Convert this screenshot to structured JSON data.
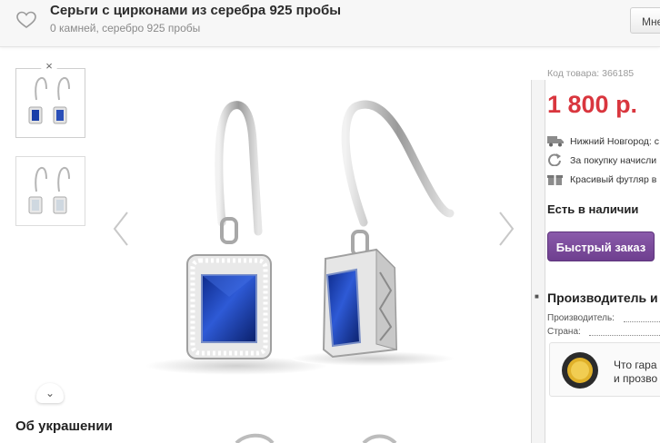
{
  "header": {
    "title": "Серьги с цирконами из серебра 925 пробы",
    "subtitle": "0 камней, серебро 925 пробы",
    "button_label": "Мне"
  },
  "gallery": {
    "close_glyph": "×",
    "scroll_glyph": "⌄"
  },
  "sections": {
    "about_title": "Об украшении"
  },
  "product": {
    "sku_label": "Код товара: 366185",
    "price": "1 800 р.",
    "delivery": "Нижний Новгород: с",
    "bonus": "За покупку начисли",
    "case": "Красивый футляр в",
    "stock_status": "Есть в наличии",
    "quick_order_label": "Быстрый заказ"
  },
  "manufacturer": {
    "title": "Производитель и",
    "producer_label": "Производитель:",
    "country_label": "Страна:",
    "guarantee_line1": "Что гара",
    "guarantee_line2": "и прозво"
  },
  "colors": {
    "price": "#d9363e",
    "button": "#7a4a9b",
    "gem": "#1a3fa8"
  }
}
